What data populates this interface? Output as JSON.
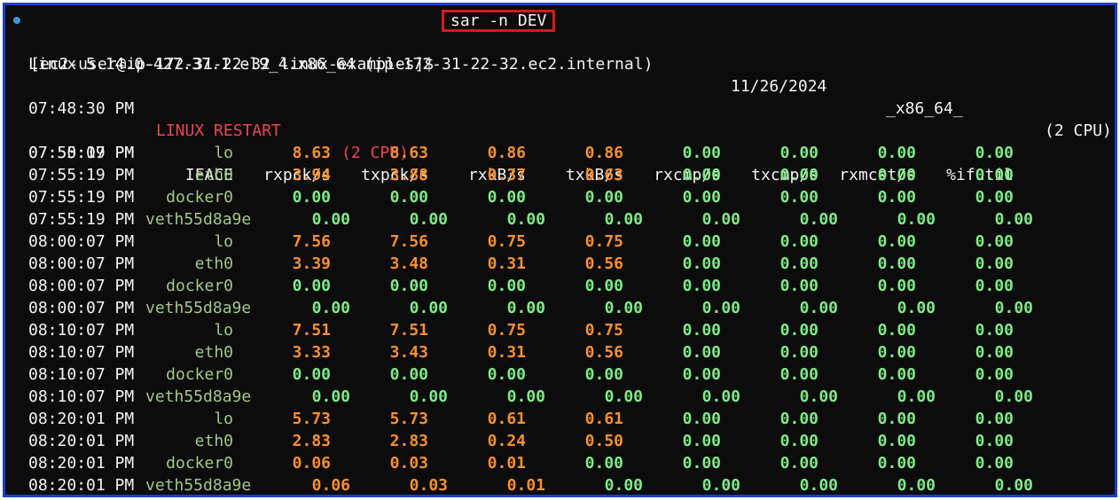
{
  "prompt": {
    "text": "[ec2-user@ip-172-31-22-32 linux-examples]$",
    "command": "sar -n DEV"
  },
  "sysinfo": {
    "kernel": "Linux 5.14.0-427.37.1.el9_4.x86_64 (ip-172-31-22-32.ec2.internal)",
    "date": "11/26/2024",
    "arch": "_x86_64_",
    "cpus": "(2 CPU)"
  },
  "restart": {
    "time": "07:48:30 PM",
    "label": "LINUX RESTART",
    "cpus": "(2 CPU)"
  },
  "table": {
    "header_time": "07:50:07 PM",
    "columns": [
      "IFACE",
      "rxpck/s",
      "txpck/s",
      "rxkB/s",
      "txkB/s",
      "rxcmp/s",
      "txcmp/s",
      "rxmcst/s",
      "%ifutil"
    ],
    "rows": [
      {
        "time": "07:55:19 PM",
        "iface": "lo",
        "values": [
          "8.63",
          "8.63",
          "0.86",
          "0.86",
          "0.00",
          "0.00",
          "0.00",
          "0.00"
        ]
      },
      {
        "time": "07:55:19 PM",
        "iface": "eth0",
        "values": [
          "3.94",
          "3.88",
          "0.37",
          "0.63",
          "0.00",
          "0.00",
          "0.00",
          "0.00"
        ]
      },
      {
        "time": "07:55:19 PM",
        "iface": "docker0",
        "values": [
          "0.00",
          "0.00",
          "0.00",
          "0.00",
          "0.00",
          "0.00",
          "0.00",
          "0.00"
        ]
      },
      {
        "time": "07:55:19 PM",
        "iface": "veth55d8a9e",
        "values": [
          "0.00",
          "0.00",
          "0.00",
          "0.00",
          "0.00",
          "0.00",
          "0.00",
          "0.00"
        ]
      },
      {
        "time": "08:00:07 PM",
        "iface": "lo",
        "values": [
          "7.56",
          "7.56",
          "0.75",
          "0.75",
          "0.00",
          "0.00",
          "0.00",
          "0.00"
        ]
      },
      {
        "time": "08:00:07 PM",
        "iface": "eth0",
        "values": [
          "3.39",
          "3.48",
          "0.31",
          "0.56",
          "0.00",
          "0.00",
          "0.00",
          "0.00"
        ]
      },
      {
        "time": "08:00:07 PM",
        "iface": "docker0",
        "values": [
          "0.00",
          "0.00",
          "0.00",
          "0.00",
          "0.00",
          "0.00",
          "0.00",
          "0.00"
        ]
      },
      {
        "time": "08:00:07 PM",
        "iface": "veth55d8a9e",
        "values": [
          "0.00",
          "0.00",
          "0.00",
          "0.00",
          "0.00",
          "0.00",
          "0.00",
          "0.00"
        ]
      },
      {
        "time": "08:10:07 PM",
        "iface": "lo",
        "values": [
          "7.51",
          "7.51",
          "0.75",
          "0.75",
          "0.00",
          "0.00",
          "0.00",
          "0.00"
        ]
      },
      {
        "time": "08:10:07 PM",
        "iface": "eth0",
        "values": [
          "3.33",
          "3.43",
          "0.31",
          "0.56",
          "0.00",
          "0.00",
          "0.00",
          "0.00"
        ]
      },
      {
        "time": "08:10:07 PM",
        "iface": "docker0",
        "values": [
          "0.00",
          "0.00",
          "0.00",
          "0.00",
          "0.00",
          "0.00",
          "0.00",
          "0.00"
        ]
      },
      {
        "time": "08:10:07 PM",
        "iface": "veth55d8a9e",
        "values": [
          "0.00",
          "0.00",
          "0.00",
          "0.00",
          "0.00",
          "0.00",
          "0.00",
          "0.00"
        ]
      },
      {
        "time": "08:20:01 PM",
        "iface": "lo",
        "values": [
          "5.73",
          "5.73",
          "0.61",
          "0.61",
          "0.00",
          "0.00",
          "0.00",
          "0.00"
        ]
      },
      {
        "time": "08:20:01 PM",
        "iface": "eth0",
        "values": [
          "2.83",
          "2.83",
          "0.24",
          "0.50",
          "0.00",
          "0.00",
          "0.00",
          "0.00"
        ]
      },
      {
        "time": "08:20:01 PM",
        "iface": "docker0",
        "values": [
          "0.06",
          "0.03",
          "0.01",
          "0.00",
          "0.00",
          "0.00",
          "0.00",
          "0.00"
        ]
      },
      {
        "time": "08:20:01 PM",
        "iface": "veth55d8a9e",
        "values": [
          "0.06",
          "0.03",
          "0.01",
          "0.00",
          "0.00",
          "0.00",
          "0.00",
          "0.00"
        ]
      }
    ]
  },
  "colors": {
    "background": "#0c0c0c",
    "border": "#1a3fd1",
    "highlight_box": "#d51a1a",
    "nonzero_value": "#f7902f",
    "zero_value": "#7dea85",
    "iface": "#a2c888",
    "restart": "#e74856"
  }
}
